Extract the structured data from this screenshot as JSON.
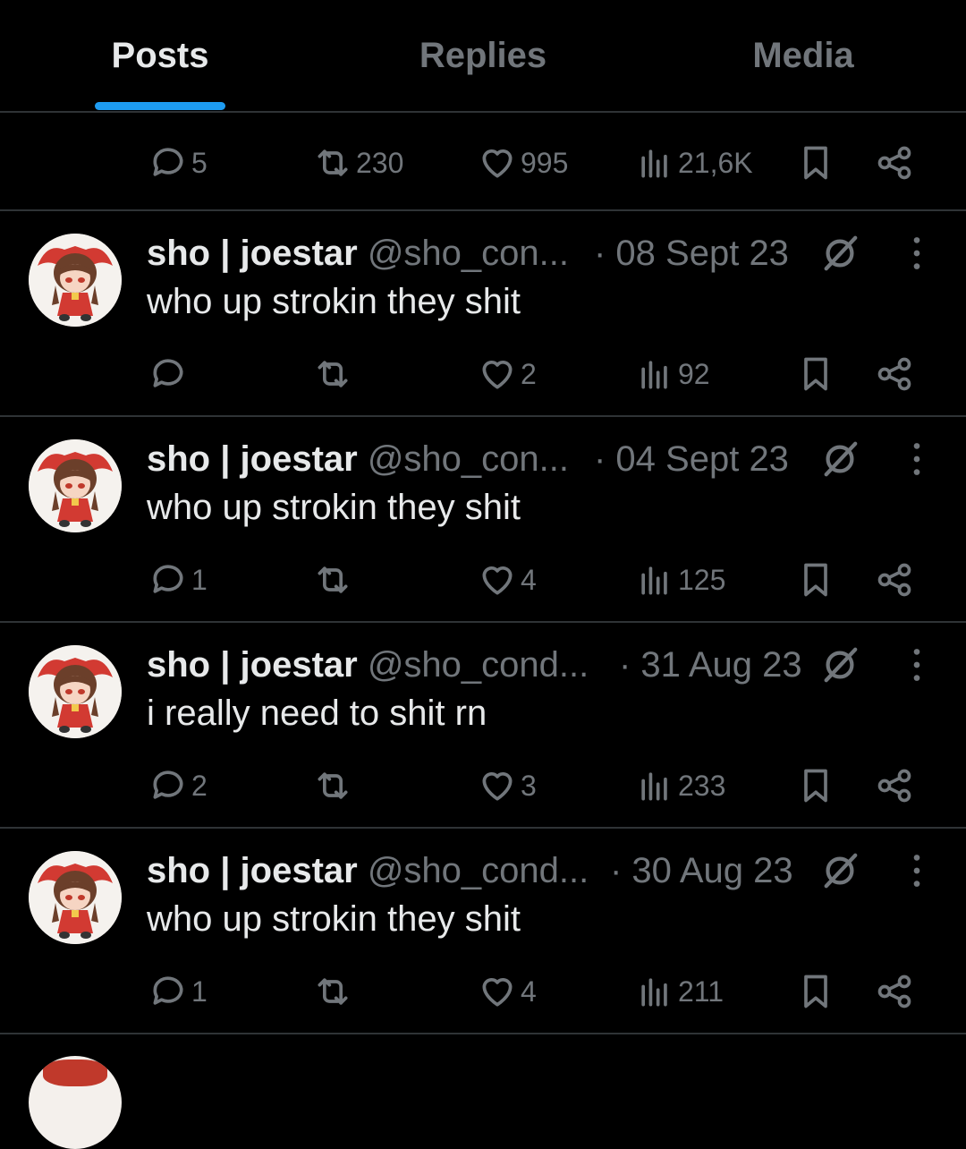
{
  "tabs": [
    {
      "label": "Posts",
      "active": true
    },
    {
      "label": "Replies",
      "active": false
    },
    {
      "label": "Media",
      "active": false
    }
  ],
  "top_actions": {
    "replies": "5",
    "reposts": "230",
    "likes": "995",
    "views": "21,6K"
  },
  "posts": [
    {
      "name": "sho | joestar",
      "handle": "@sho_con...",
      "time": "· 08 Sept 23",
      "text": "who up strokin they shit",
      "replies": "",
      "reposts": "",
      "likes": "2",
      "views": "92"
    },
    {
      "name": "sho | joestar",
      "handle": "@sho_con...",
      "time": "· 04 Sept 23",
      "text": "who up strokin they shit",
      "replies": "1",
      "reposts": "",
      "likes": "4",
      "views": "125"
    },
    {
      "name": "sho | joestar",
      "handle": "@sho_cond...",
      "time": "· 31 Aug 23",
      "text": "i really need to shit rn",
      "replies": "2",
      "reposts": "",
      "likes": "3",
      "views": "233"
    },
    {
      "name": "sho | joestar",
      "handle": "@sho_cond...",
      "time": "· 30 Aug 23",
      "text": "who up strokin they shit",
      "replies": "1",
      "reposts": "",
      "likes": "4",
      "views": "211"
    }
  ],
  "colors": {
    "background": "#000000",
    "text": "#e7e9ea",
    "muted": "#71767b",
    "accent": "#1d9bf0",
    "divider": "#2f3336"
  },
  "icons": [
    "reply-icon",
    "repost-icon",
    "like-icon",
    "views-icon",
    "bookmark-icon",
    "share-icon",
    "grok-icon",
    "more-icon"
  ]
}
